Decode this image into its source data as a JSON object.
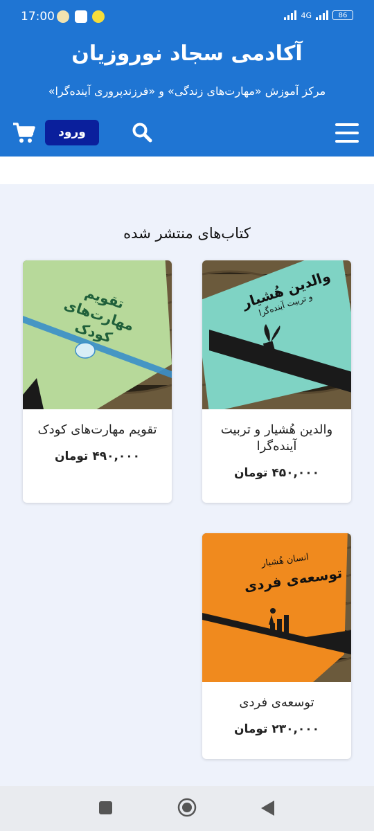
{
  "status_bar": {
    "time": "17:00",
    "network": "4G",
    "battery": "86"
  },
  "header": {
    "title": "آکادمی سجاد نوروزیان",
    "subtitle": "مرکز آموزش «مهارت‌های زندگی» و «فرزندپروری آینده‌گرا»",
    "login_label": "ورود",
    "menu_icon": "hamburger-menu-icon",
    "search_icon": "search-icon",
    "cart_icon": "shopping-cart-icon",
    "colors": {
      "bar": "#1f75d3",
      "login_button": "#0a1f9c"
    }
  },
  "section": {
    "title": "کتاب‌های منتشر شده"
  },
  "books": [
    {
      "name": "والدین هُشیار و تربیت آینده‌گرا",
      "price": "۴۵۰,۰۰۰ تومان",
      "cover_title": "والدین هُشیار",
      "cover_subtitle": "و تربیت آینده‌گرا",
      "cover_color": "#7fd3c4"
    },
    {
      "name": "تقویم مهارت‌های کودک",
      "price": "۴۹۰,۰۰۰ تومان",
      "cover_title": "تقویم مهارت‌های کودک",
      "cover_color": "#b7d99a"
    },
    {
      "name": "توسعه‌ی فردی",
      "price": "۲۳۰,۰۰۰ تومان",
      "cover_title": "توسعه‌ی فردی",
      "cover_subtitle": "انسان هُشیار",
      "cover_color": "#f08a1e"
    }
  ],
  "nav_bar": {
    "recents_icon": "square-icon",
    "home_icon": "circle-home-icon",
    "back_icon": "back-triangle-icon"
  }
}
